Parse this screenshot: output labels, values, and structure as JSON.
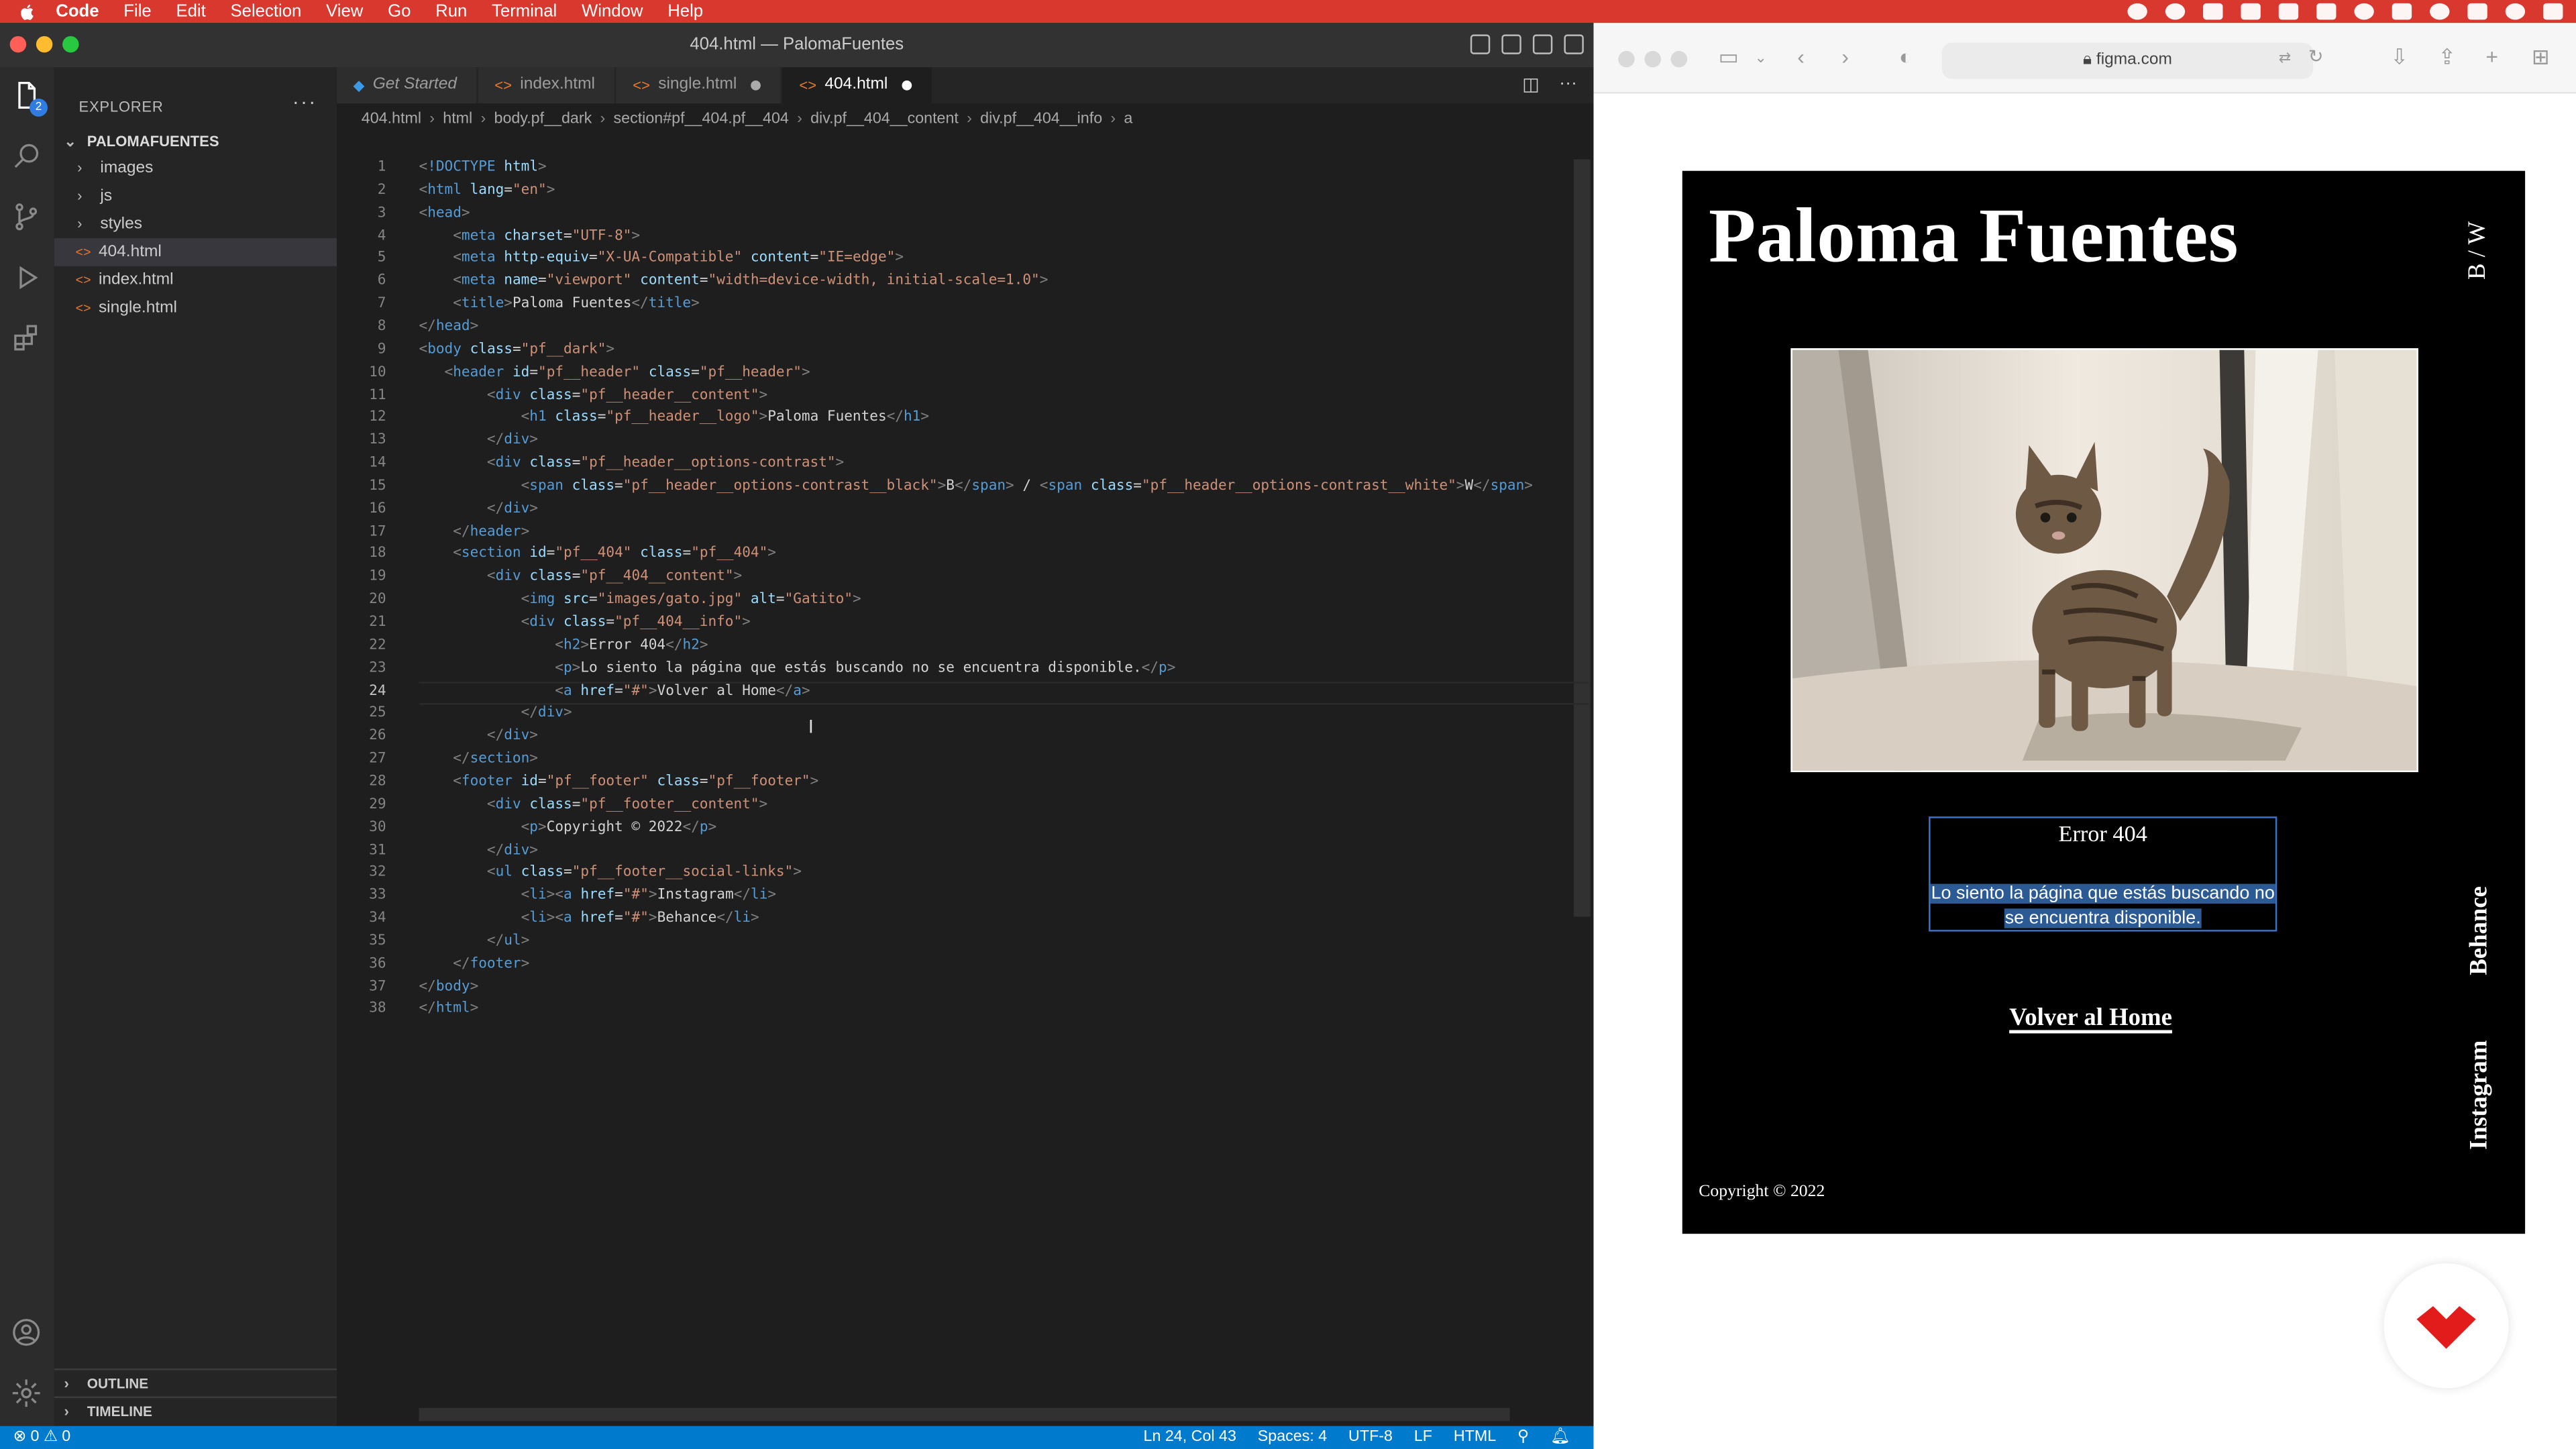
{
  "menubar": {
    "items": [
      "Code",
      "File",
      "Edit",
      "Selection",
      "View",
      "Go",
      "Run",
      "Terminal",
      "Window",
      "Help"
    ]
  },
  "vscode": {
    "window_title": "404.html — PalomaFuentes",
    "explorer": {
      "header": "EXPLORER",
      "root": "PALOMAFUENTES",
      "folders": [
        "images",
        "js",
        "styles"
      ],
      "files": [
        "404.html",
        "index.html",
        "single.html"
      ],
      "selected_file": "404.html",
      "bottom_sections": [
        "OUTLINE",
        "TIMELINE"
      ]
    },
    "activity_badge": "2",
    "tabs": [
      {
        "label": "Get Started",
        "icon": "vscode-icon"
      },
      {
        "label": "index.html",
        "icon": "html-file-icon"
      },
      {
        "label": "single.html",
        "icon": "html-file-icon",
        "modified": true
      },
      {
        "label": "404.html",
        "icon": "html-file-icon",
        "modified": true,
        "active": true
      }
    ],
    "breadcrumb": [
      "404.html",
      "html",
      "body.pf__dark",
      "section#pf__404.pf__404",
      "div.pf__404__content",
      "div.pf__404__info",
      "a"
    ],
    "code_lines": [
      "<!DOCTYPE html>",
      "<html lang=\"en\">",
      "<head>",
      "    <meta charset=\"UTF-8\">",
      "    <meta http-equiv=\"X-UA-Compatible\" content=\"IE=edge\">",
      "    <meta name=\"viewport\" content=\"width=device-width, initial-scale=1.0\">",
      "    <title>Paloma Fuentes</title>",
      "</head>",
      "<body class=\"pf__dark\">",
      "   <header id=\"pf__header\" class=\"pf__header\">",
      "        <div class=\"pf__header__content\">",
      "            <h1 class=\"pf__header__logo\">Paloma Fuentes</h1>",
      "        </div>",
      "        <div class=\"pf__header__options-contrast\">",
      "            <span class=\"pf__header__options-contrast__black\">B</span> / <span class=\"pf__header__options-contrast__white\">W</span>",
      "        </div>",
      "    </header>",
      "    <section id=\"pf__404\" class=\"pf__404\">",
      "        <div class=\"pf__404__content\">",
      "            <img src=\"images/gato.jpg\" alt=\"Gatito\">",
      "            <div class=\"pf__404__info\">",
      "                <h2>Error 404</h2>",
      "                <p>Lo siento la página que estás buscando no se encuentra disponible.</p>",
      "                <a href=\"#\">Volver al Home</a>",
      "            </div>",
      "        </div>",
      "    </section>",
      "    <footer id=\"pf__footer\" class=\"pf__footer\">",
      "        <div class=\"pf__footer__content\">",
      "            <p>Copyright © 2022</p>",
      "        </div>",
      "        <ul class=\"pf__footer__social-links\">",
      "            <li><a href=\"#\">Instagram</li>",
      "            <li><a href=\"#\">Behance</li>",
      "        </ul>",
      "    </footer>",
      "</body>",
      "</html>"
    ],
    "current_line": 24,
    "status": {
      "problems": "⊗ 0 ⚠ 0",
      "position": "Ln 24, Col 43",
      "spaces": "Spaces: 4",
      "encoding": "UTF-8",
      "eol": "LF",
      "language": "HTML"
    }
  },
  "safari": {
    "url": "figma.com"
  },
  "site": {
    "logo": "Paloma Fuentes",
    "contrast_toggle": "B / W",
    "image_alt": "Gatito",
    "error_title": "Error 404",
    "error_message": "Lo siento la página que estás buscando no se encuentra disponible.",
    "home_link": "Volver al Home",
    "social_links": [
      "Behance",
      "Instagram"
    ],
    "copyright": "Copyright © 2022"
  },
  "colors": {
    "menubar": "#d8382e",
    "statusbar": "#007acc",
    "site_background": "#000000",
    "selection_box": "#3a74c8",
    "badge_logo": "#e21b1b"
  }
}
